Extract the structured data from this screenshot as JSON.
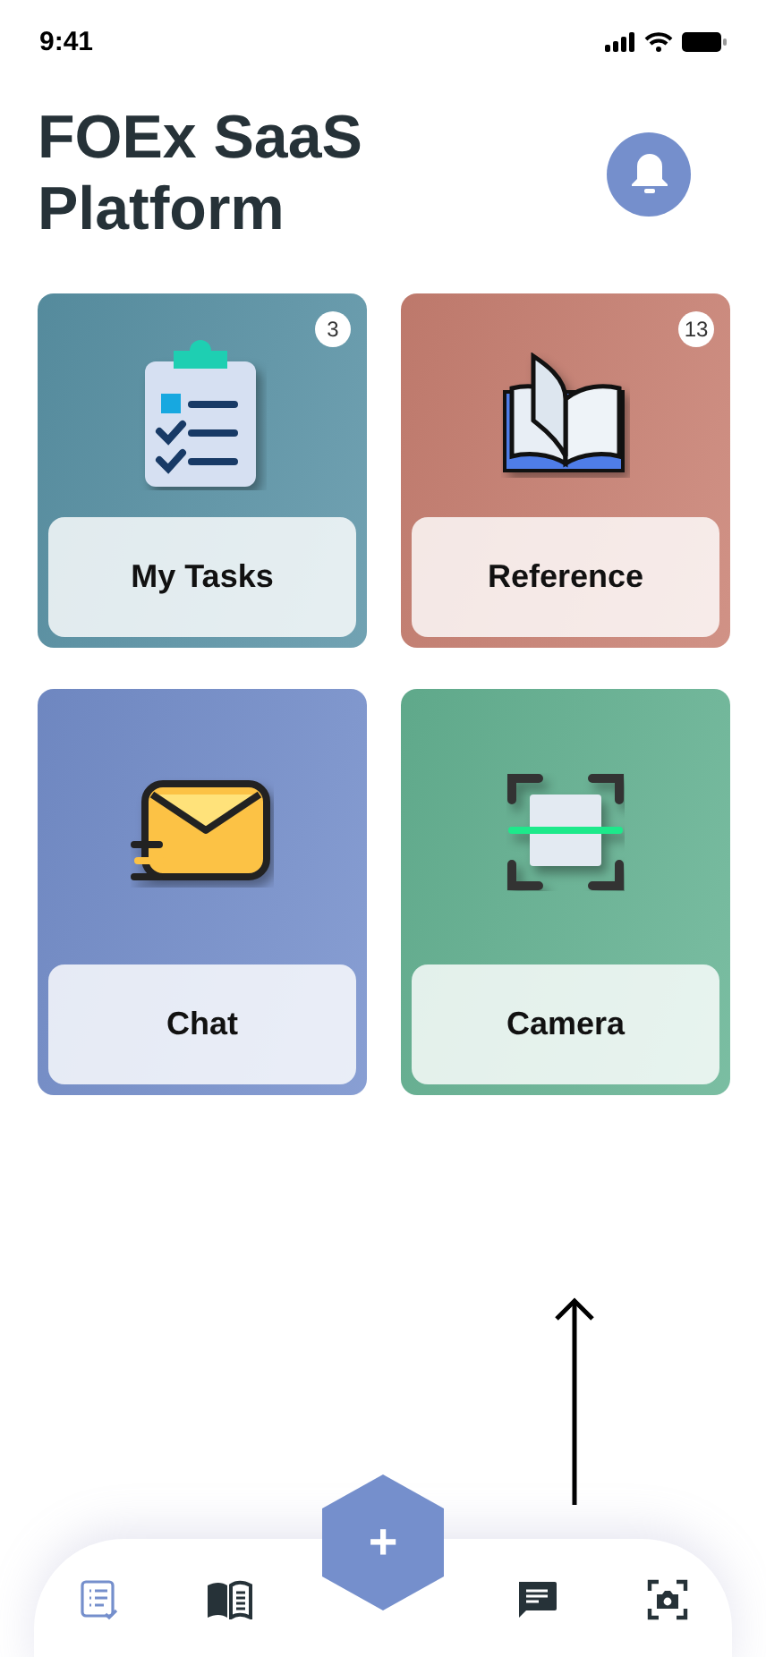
{
  "status_bar": {
    "time": "9:41"
  },
  "header": {
    "title": "FOEx SaaS Platform"
  },
  "cards": [
    {
      "kind": "tasks",
      "label": "My Tasks",
      "badge": "3",
      "color": "#5a93a6"
    },
    {
      "kind": "book",
      "label": "Reference",
      "badge": "13",
      "color": "#c98072"
    },
    {
      "kind": "mail",
      "label": "Chat",
      "color": "#758fcc"
    },
    {
      "kind": "scan",
      "label": "Camera",
      "color": "#65b393"
    }
  ],
  "bottom_nav": {
    "items": [
      {
        "kind": "tasks",
        "selected": true
      },
      {
        "kind": "book",
        "selected": false
      },
      {
        "kind": "chat",
        "selected": false
      },
      {
        "kind": "camera",
        "selected": false
      }
    ],
    "add_button": {
      "label": "+"
    }
  }
}
